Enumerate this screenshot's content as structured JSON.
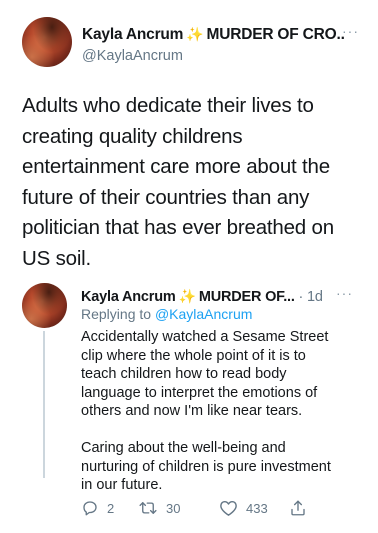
{
  "main_tweet": {
    "author_name": "Kayla Ancrum",
    "name_sparkle": "✨",
    "name_suffix": "MURDER OF CRO...",
    "handle": "@KaylaAncrum",
    "more": "···",
    "text_lines": [
      "Adults who dedicate their lives to",
      "creating quality childrens",
      "entertainment care more about the",
      "future of their countries than any",
      "politician that has ever breathed on",
      "US soil."
    ]
  },
  "reply_tweet": {
    "author_name": "Kayla Ancrum",
    "name_sparkle": "✨",
    "name_suffix": "MURDER OF...",
    "time": "· 1d",
    "more": "···",
    "replying_prefix": "Replying to",
    "replying_handle": "@KaylaAncrum",
    "paragraph1_lines": [
      "Accidentally watched a Sesame Street",
      "clip where the whole point of it is to",
      "teach children how to read body",
      "language to interpret the emotions of",
      "others and now I'm like near tears."
    ],
    "paragraph2_lines": [
      "Caring about the well-being and",
      "nurturing of children is pure investment",
      "in our future."
    ],
    "actions": {
      "reply_count": "2",
      "retweet_count": "30",
      "like_count": "433",
      "reply_icon": "reply-icon",
      "retweet_icon": "retweet-icon",
      "like_icon": "heart-icon",
      "share_icon": "share-icon"
    }
  },
  "colors": {
    "text": "#14171a",
    "secondary": "#657786",
    "link": "#1da1f2",
    "thread_line": "#ccd6dd"
  }
}
